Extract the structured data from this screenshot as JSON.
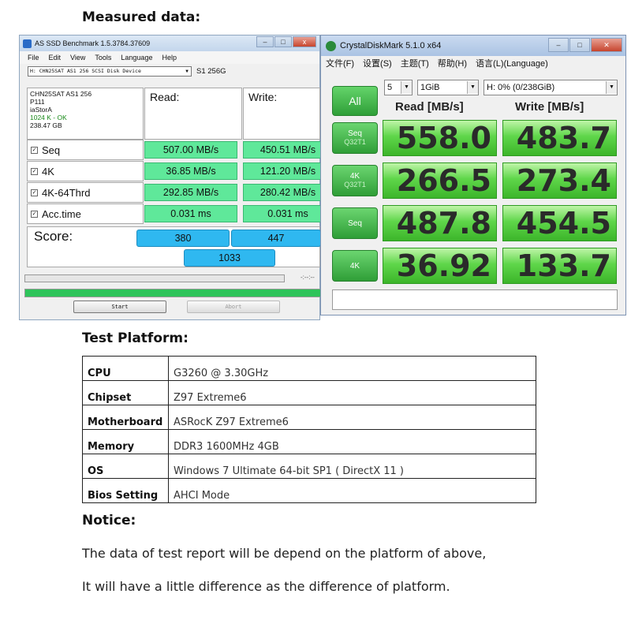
{
  "headings": {
    "measured": "Measured data:",
    "platform": "Test Platform:",
    "notice": "Notice:"
  },
  "asssd": {
    "title": "AS SSD Benchmark 1.5.3784.37609",
    "menu": [
      "File",
      "Edit",
      "View",
      "Tools",
      "Language",
      "Help"
    ],
    "device_select": "H: CHN25SAT AS1 256 SCSI Disk Device",
    "device_label": "S1 256G",
    "info": {
      "model": "CHN25SAT AS1 256",
      "firmware": "P111",
      "driver": "iaStorA",
      "align": "1024 K - OK",
      "size": "238.47 GB"
    },
    "col_read": "Read:",
    "col_write": "Write:",
    "rows": [
      {
        "label": "Seq",
        "read": "507.00 MB/s",
        "write": "450.51 MB/s"
      },
      {
        "label": "4K",
        "read": "36.85 MB/s",
        "write": "121.20 MB/s"
      },
      {
        "label": "4K-64Thrd",
        "read": "292.85 MB/s",
        "write": "280.42 MB/s"
      },
      {
        "label": "Acc.time",
        "read": "0.031 ms",
        "write": "0.031 ms"
      }
    ],
    "score_label": "Score:",
    "score_read": "380",
    "score_write": "447",
    "score_total": "1033",
    "time_readout": "-:--:--",
    "start_label": "Start",
    "abort_label": "Abort",
    "colors": {
      "value_green": "#5fe89a",
      "score_blue": "#2fb8f0",
      "progress_green": "#2ec45a"
    }
  },
  "cdm": {
    "title": "CrystalDiskMark 5.1.0 x64",
    "menu": [
      "文件(F)",
      "设置(S)",
      "主题(T)",
      "帮助(H)",
      "语言(L)(Language)"
    ],
    "all_label": "All",
    "count": "5",
    "size": "1GiB",
    "drive": "H: 0% (0/238GiB)",
    "read_header": "Read [MB/s]",
    "write_header": "Write [MB/s]",
    "rows": [
      {
        "label": "Seq",
        "sub": "Q32T1",
        "read": "558.0",
        "write": "483.7"
      },
      {
        "label": "4K",
        "sub": "Q32T1",
        "read": "266.5",
        "write": "273.4"
      },
      {
        "label": "Seq",
        "sub": "",
        "read": "487.8",
        "write": "454.5"
      },
      {
        "label": "4K",
        "sub": "",
        "read": "36.92",
        "write": "133.7"
      }
    ],
    "colors": {
      "tile_green": "#5fd64a",
      "button_green": "#2f9f38"
    }
  },
  "platform": [
    {
      "key": "CPU",
      "value": "G3260 @ 3.30GHz"
    },
    {
      "key": "Chipset",
      "value": "Z97 Extreme6"
    },
    {
      "key": "Motherboard",
      "value": "ASRocK Z97 Extreme6"
    },
    {
      "key": "Memory",
      "value": "DDR3 1600MHz 4GB"
    },
    {
      "key": "OS",
      "value": "Windows 7 Ultimate 64-bit SP1 ( DirectX 11 )"
    },
    {
      "key": "Bios Setting",
      "value": "AHCI Mode"
    }
  ],
  "notice": {
    "line1": "The data of test report will be depend on the platform of above,",
    "line2": "It will have a little difference as the difference of platform."
  }
}
